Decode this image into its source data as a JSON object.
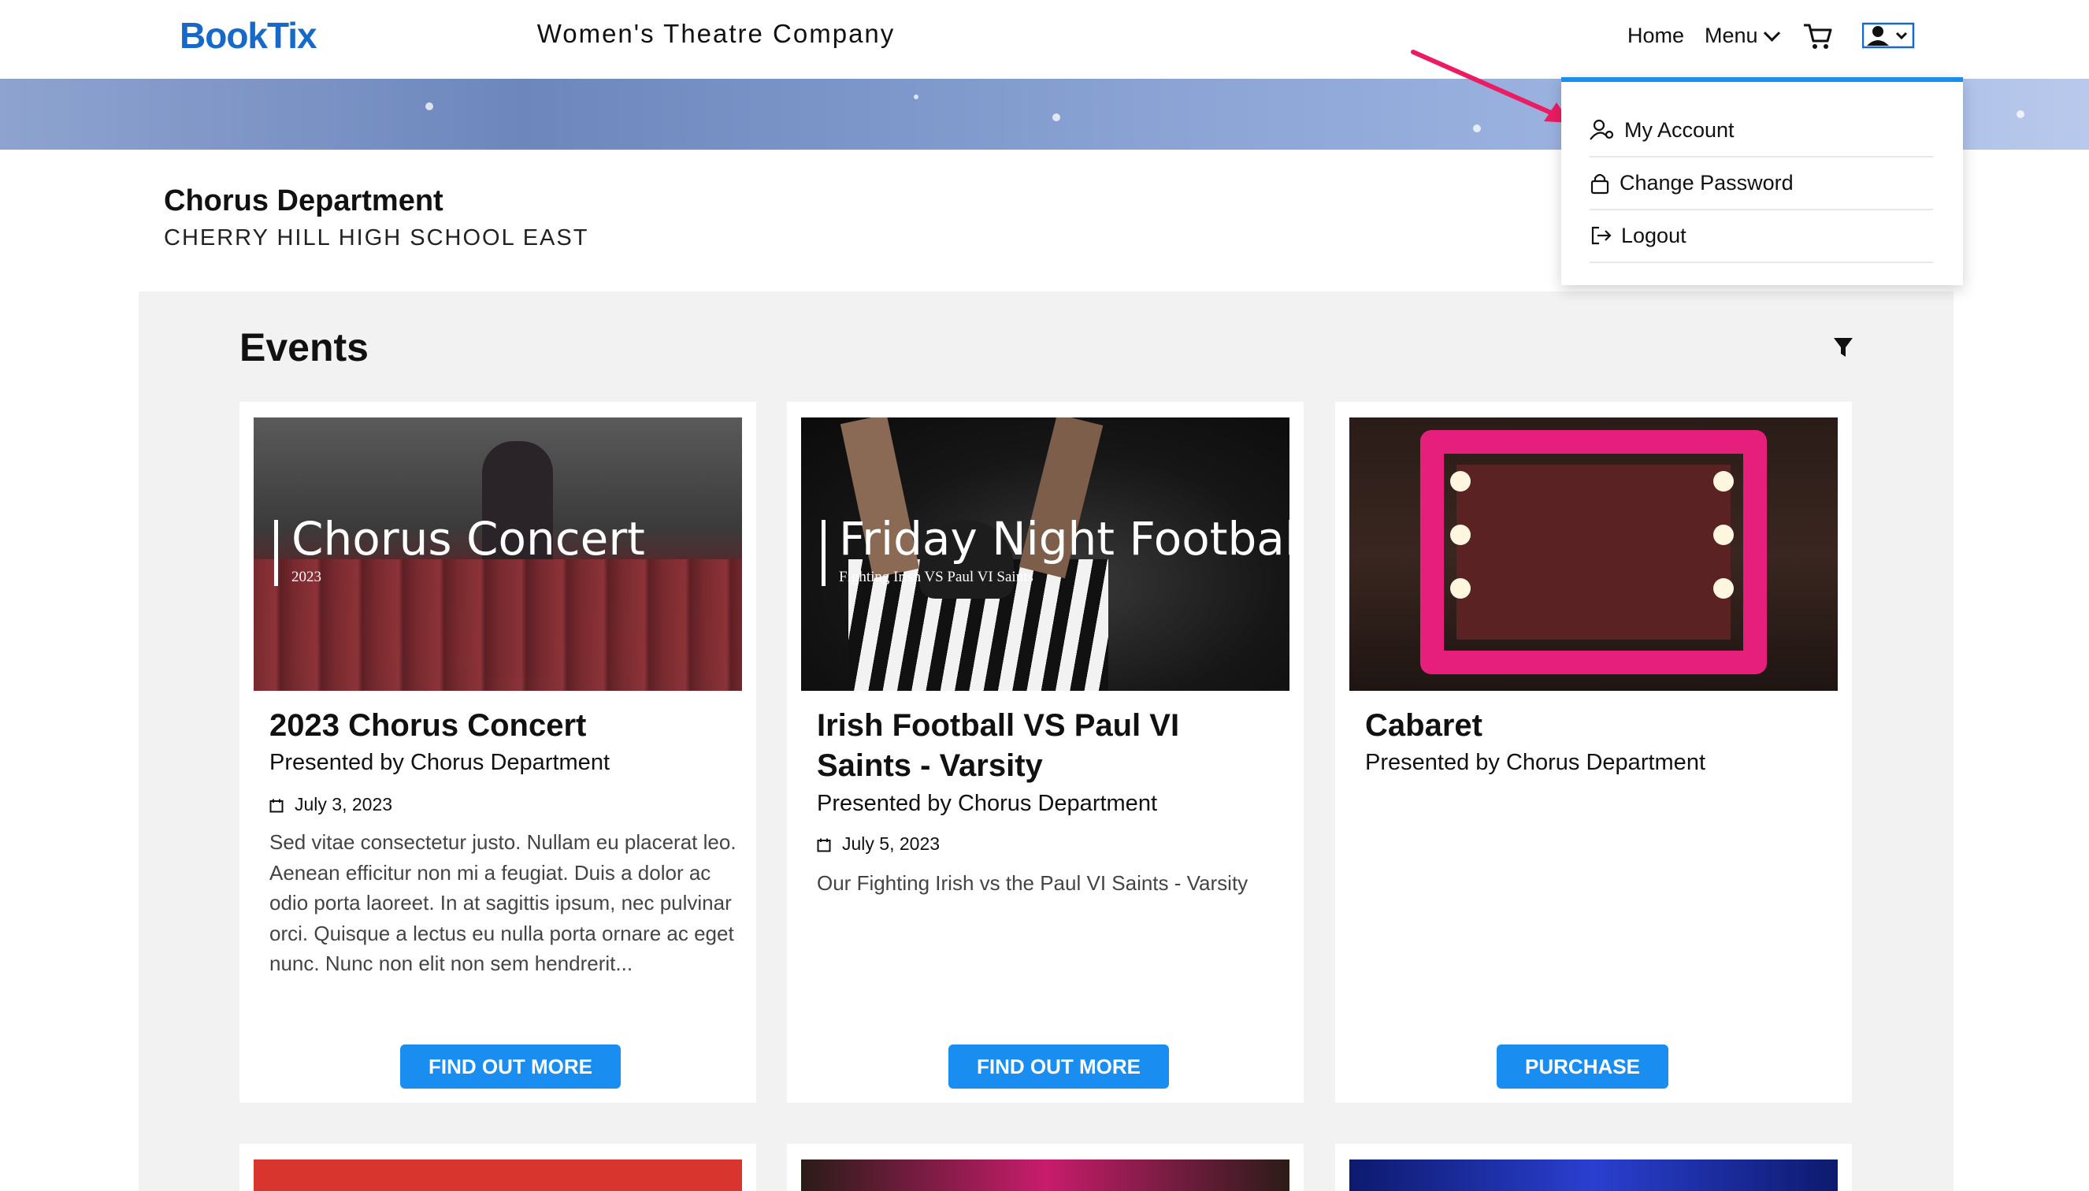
{
  "header": {
    "logo": "BookTix",
    "org_title": "Women's Theatre Company",
    "nav_home": "Home",
    "nav_menu": "Menu",
    "cart_icon": "cart-icon",
    "user_icon": "user-account-icon"
  },
  "department": {
    "name": "Chorus Department",
    "school": "CHERRY HILL HIGH SCHOOL EAST"
  },
  "events": {
    "title": "Events",
    "filter_icon": "filter-icon",
    "cards": [
      {
        "image_title": "Chorus Concert",
        "image_subtitle": "2023",
        "title": "2023 Chorus Concert",
        "presenter": "Presented by Chorus Department",
        "date": "July 3, 2023",
        "description": "Sed vitae consectetur justo. Nullam eu placerat leo. Aenean efficitur non mi a feugiat. Duis a dolor ac odio porta laoreet. In at sagittis ipsum, nec pulvinar orci. Quisque a lectus eu nulla porta ornare ac eget nunc. Nunc non elit non sem hendrerit...",
        "button": "FIND OUT MORE"
      },
      {
        "image_title": "Friday Night Football",
        "image_subtitle": "Fighting Irish VS Paul VI Saints",
        "title": "Irish Football VS Paul VI Saints - Varsity",
        "presenter": "Presented by Chorus Department",
        "date": "July 5, 2023",
        "description": "Our Fighting Irish vs the Paul VI Saints - Varsity",
        "button": "FIND OUT MORE"
      },
      {
        "image_title": "",
        "image_subtitle": "",
        "title": "Cabaret",
        "presenter": "Presented by Chorus Department",
        "date": "",
        "description": "",
        "button": "PURCHASE"
      }
    ]
  },
  "dropdown": {
    "items": [
      {
        "label": "My Account",
        "icon": "user-settings-icon"
      },
      {
        "label": "Change Password",
        "icon": "lock-icon"
      },
      {
        "label": "Logout",
        "icon": "logout-icon"
      }
    ]
  },
  "colors": {
    "brand": "#1668c9",
    "accent": "#1a8df1",
    "annotation_arrow": "#ec1c63"
  }
}
